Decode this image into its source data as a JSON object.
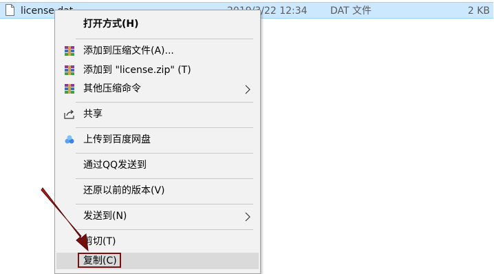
{
  "file_row": {
    "name": "license.dat",
    "date": "2019/3/22 12:34",
    "type": "DAT 文件",
    "size": "2 KB",
    "icon": "document-icon"
  },
  "context_menu": {
    "items": [
      {
        "label": "打开方式(H)",
        "bold": true
      },
      {
        "label": "添加到压缩文件(A)...",
        "icon": "winrar-icon"
      },
      {
        "label": "添加到 \"license.zip\" (T)",
        "icon": "winrar-icon"
      },
      {
        "label": "其他压缩命令",
        "icon": "winrar-icon",
        "submenu": true
      },
      {
        "label": "共享",
        "icon": "share-icon"
      },
      {
        "label": "上传到百度网盘",
        "icon": "baidu-netdisk-icon"
      },
      {
        "label": "通过QQ发送到"
      },
      {
        "label": "还原以前的版本(V)"
      },
      {
        "label": "发送到(N)",
        "submenu": true
      },
      {
        "label": "剪切(T)"
      },
      {
        "label": "复制(C)",
        "highlighted": true
      }
    ]
  },
  "colors": {
    "selection": "#cce8ff",
    "menu_bg": "#f2f2f2",
    "menu_hover": "#dadada",
    "annotation": "#7a0f0f"
  }
}
